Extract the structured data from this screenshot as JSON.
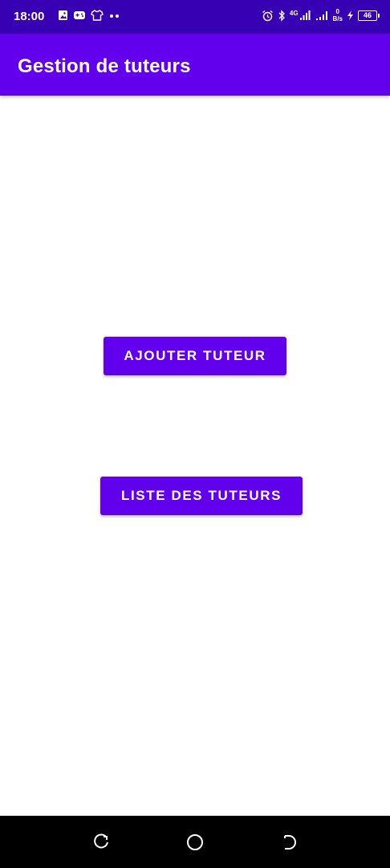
{
  "status_bar": {
    "time": "18:00",
    "network_type": "4G",
    "speed_value": "0",
    "speed_unit": "B/s",
    "battery": "46"
  },
  "app_bar": {
    "title": "Gestion de tuteurs"
  },
  "main": {
    "add_button_label": "AJOUTER TUTEUR",
    "list_button_label": "LISTE DES TUTEURS"
  },
  "icons": {
    "status_left": [
      "image-icon",
      "gamepad-icon",
      "shirt-icon",
      "more-dots-icon"
    ],
    "status_right": [
      "alarm-icon",
      "bluetooth-icon",
      "signal-icon",
      "signal-icon",
      "charging-icon",
      "battery-icon"
    ],
    "nav": [
      "recent-apps-icon",
      "home-icon",
      "back-icon"
    ]
  },
  "colors": {
    "status_bar": "#3700B3",
    "primary": "#6200EE",
    "background": "#FFFFFF",
    "nav_bar": "#000000"
  }
}
